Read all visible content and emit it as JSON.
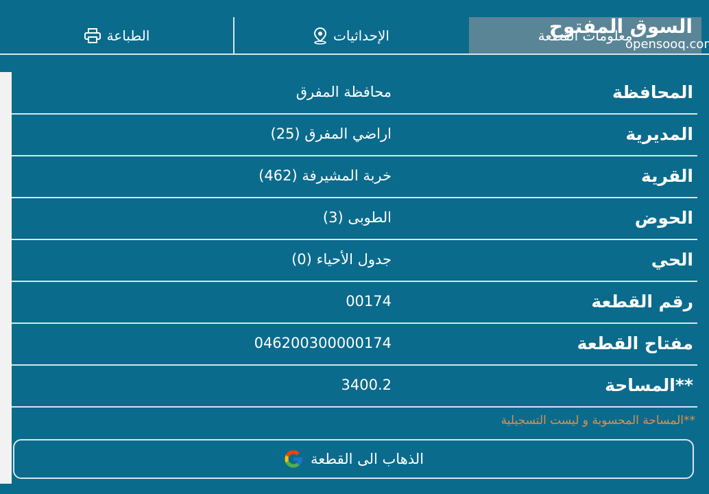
{
  "brand": {
    "name_ar": "السوق المفتوح",
    "name_en": "opensooq.com"
  },
  "tabs": [
    {
      "label": "معلومات القطعة",
      "active": true
    },
    {
      "label": "الإحداثيات",
      "icon": "location-pin-icon"
    },
    {
      "label": "الطباعة",
      "icon": "printer-icon"
    }
  ],
  "details": [
    {
      "label": "المحافظة",
      "value": "محافظة المفرق"
    },
    {
      "label": "المديرية",
      "value": "اراضي المفرق (25)"
    },
    {
      "label": "القرية",
      "value": "خربة المشيرفة (462)"
    },
    {
      "label": "الحوض",
      "value": "الطوبى (3)"
    },
    {
      "label": "الحي",
      "value": "جدول الأحياء (0)"
    },
    {
      "label": "رقم القطعة",
      "value": "00174"
    },
    {
      "label": "مفتاح القطعة",
      "value": "046200300000174"
    },
    {
      "label": "**المساحة",
      "value": "3400.2"
    }
  ],
  "note": "**المساحة المحسوبة و ليست التسجيلية",
  "go_button": {
    "label": "الذهاب الى القطعة",
    "icon": "google-icon"
  },
  "colors": {
    "background": "#0b6b8c",
    "active_tab": "#5a8597",
    "note": "#e0904a",
    "divider": "#d8e6ec"
  }
}
